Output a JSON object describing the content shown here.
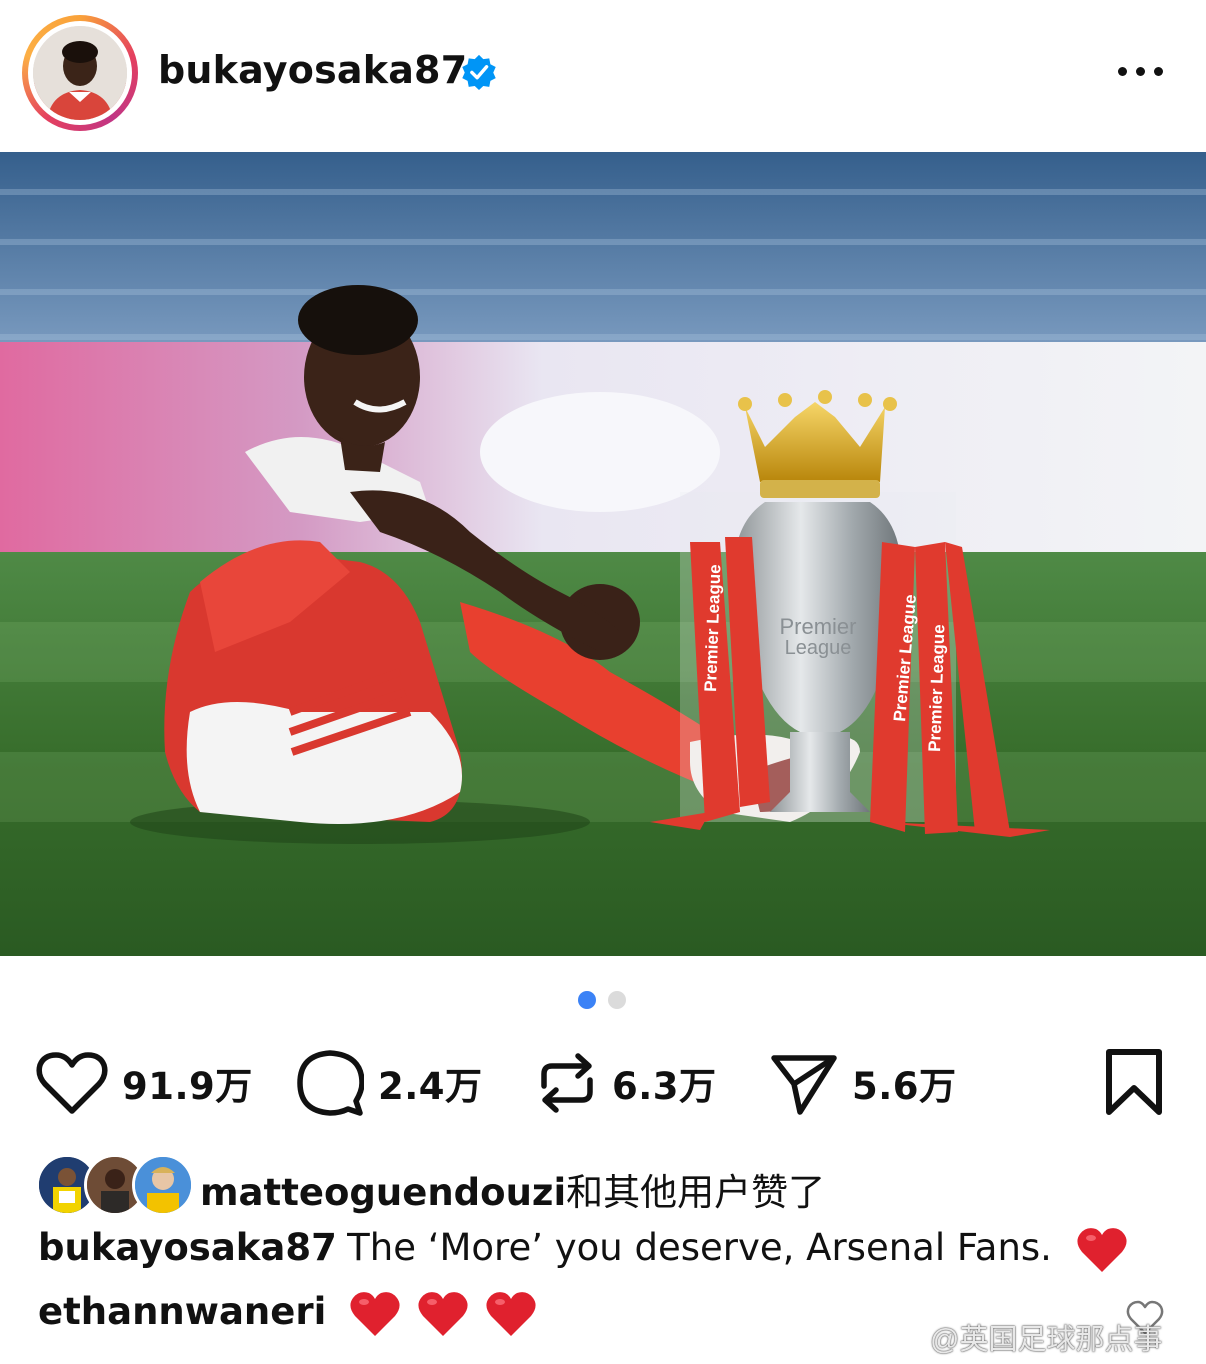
{
  "header": {
    "username": "bukayosaka87",
    "verified_icon": "verified-badge-icon",
    "more_icon": "more-horizontal-icon"
  },
  "photo": {
    "alt_description": "",
    "trophy_ribbon_text": "Premier League",
    "trophy_engraving": "Premier League"
  },
  "carousel": {
    "current": 1,
    "total": 2
  },
  "actions": {
    "likes": "91.9万",
    "comments": "2.4万",
    "reposts": "6.3万",
    "shares": "5.6万"
  },
  "liked_by": {
    "user": "matteoguendouzi",
    "suffix": "和其他用户赞了"
  },
  "caption": {
    "user": "bukayosaka87",
    "text": "The ‘More’ you deserve, Arsenal Fans."
  },
  "comment": {
    "user": "ethannwaneri"
  },
  "watermark": "@英国足球那点事",
  "colors": {
    "accent": "#3b82f6",
    "heart_red": "#e0212e",
    "verified_blue": "#0095f6"
  }
}
